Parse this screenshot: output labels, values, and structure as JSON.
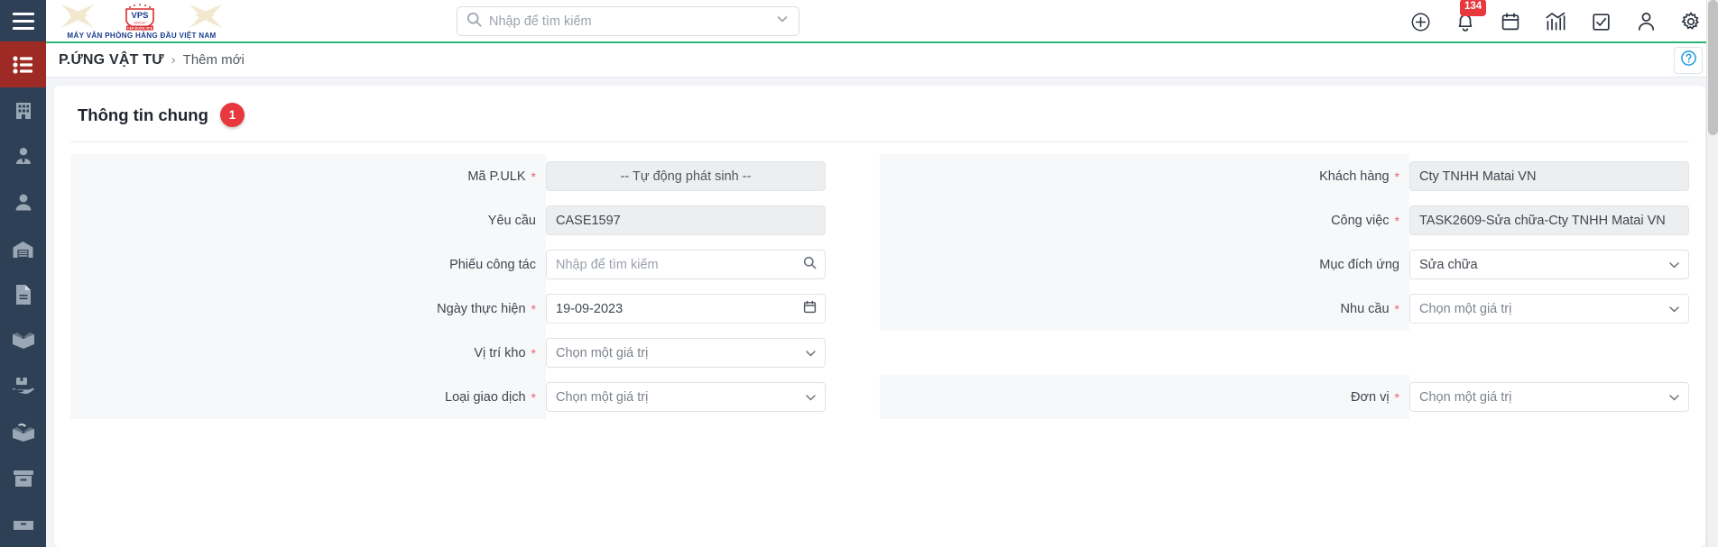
{
  "brand": {
    "logo_mark": "VPS",
    "logo_sub": "TẬP ĐOÀN VPS",
    "logo_tagline": "MÁY VĂN PHÒNG HÀNG ĐẦU VIỆT NAM"
  },
  "topbar": {
    "menu_icon": "hamburger-menu-icon",
    "search": {
      "placeholder": "Nhập để tìm kiếm",
      "value": "",
      "icon": "search-icon",
      "caret_icon": "chevron-down-icon"
    },
    "icons": [
      {
        "name": "add-circle-icon",
        "label": ""
      },
      {
        "name": "notification-bell-icon",
        "label": "",
        "badge": "134"
      },
      {
        "name": "calendar-icon",
        "label": ""
      },
      {
        "name": "analytics-chart-icon",
        "label": ""
      },
      {
        "name": "task-checkbox-icon",
        "label": ""
      },
      {
        "name": "user-account-icon",
        "label": ""
      },
      {
        "name": "settings-gear-icon",
        "label": ""
      }
    ]
  },
  "breadcrumb": {
    "root": "P.ỨNG VẬT TƯ",
    "separator": "›",
    "current": "Thêm mới",
    "help_icon": "question-circle-icon"
  },
  "sidebar": {
    "items": [
      {
        "name": "sidebar-item-list",
        "icon": "list-icon",
        "active": true
      },
      {
        "name": "sidebar-item-company",
        "icon": "building-icon",
        "active": false
      },
      {
        "name": "sidebar-item-employee",
        "icon": "user-tie-icon",
        "active": false
      },
      {
        "name": "sidebar-item-customer",
        "icon": "user-icon",
        "active": false
      },
      {
        "name": "sidebar-item-warehouse",
        "icon": "warehouse-icon",
        "active": false
      },
      {
        "name": "sidebar-item-document",
        "icon": "file-document-icon",
        "active": false
      },
      {
        "name": "sidebar-item-inbound",
        "icon": "box-open-icon",
        "active": false
      },
      {
        "name": "sidebar-item-delivery",
        "icon": "hand-holding-box-icon",
        "active": false
      },
      {
        "name": "sidebar-item-return",
        "icon": "box-return-icon",
        "active": false
      },
      {
        "name": "sidebar-item-archive",
        "icon": "archive-box-icon",
        "active": false
      },
      {
        "name": "sidebar-item-more",
        "icon": "drawer-icon",
        "active": false
      }
    ]
  },
  "card": {
    "title": "Thông tin chung",
    "step_badge": "1"
  },
  "form": {
    "left": [
      {
        "name": "ma-pulk",
        "label": "Mã P.ULK",
        "required": true,
        "control": "readonly-input",
        "value": "-- Tự động phát sinh --",
        "placeholder": ""
      },
      {
        "name": "yeu-cau",
        "label": "Yêu cầu",
        "required": false,
        "control": "readonly-input",
        "value": "CASE1597",
        "placeholder": ""
      },
      {
        "name": "phieu-cong-tac",
        "label": "Phiếu công tác",
        "required": false,
        "control": "search-input",
        "value": "",
        "placeholder": "Nhập để tìm kiếm",
        "addon_icon": "search-icon"
      },
      {
        "name": "ngay-thuc-hien",
        "label": "Ngày thực hiện",
        "required": true,
        "control": "date-input",
        "value": "19-09-2023",
        "placeholder": "",
        "addon_icon": "calendar-icon"
      },
      {
        "name": "vi-tri-kho",
        "label": "Vị trí kho",
        "required": true,
        "control": "select",
        "value": "",
        "placeholder": "Chọn một giá trị",
        "caret_icon": "chevron-down-icon"
      },
      {
        "name": "loai-giao-dich",
        "label": "Loại giao dịch",
        "required": true,
        "control": "select",
        "value": "",
        "placeholder": "Chọn một giá trị",
        "caret_icon": "chevron-down-icon"
      }
    ],
    "right": [
      {
        "name": "khach-hang",
        "label": "Khách hàng",
        "required": true,
        "control": "readonly-input",
        "value": "Cty TNHH Matai VN",
        "placeholder": ""
      },
      {
        "name": "cong-viec",
        "label": "Công việc",
        "required": true,
        "control": "readonly-input",
        "value": "TASK2609-Sửa chữa-Cty TNHH Matai VN",
        "placeholder": ""
      },
      {
        "name": "muc-dich-ung",
        "label": "Mục đích ứng",
        "required": false,
        "control": "select",
        "value": "Sửa chữa",
        "placeholder": "Chọn một giá trị",
        "caret_icon": "chevron-down-icon"
      },
      {
        "name": "nhu-cau",
        "label": "Nhu cầu",
        "required": true,
        "control": "select",
        "value": "",
        "placeholder": "Chọn một giá trị",
        "caret_icon": "chevron-down-icon"
      },
      {
        "name": "spacer-1",
        "label": "",
        "required": false,
        "control": "empty",
        "value": "",
        "placeholder": ""
      },
      {
        "name": "don-vi",
        "label": "Đơn vị",
        "required": true,
        "control": "select",
        "value": "",
        "placeholder": "Chọn một giá trị",
        "caret_icon": "chevron-down-icon"
      }
    ]
  },
  "colors": {
    "sidebar_bg": "#2e4055",
    "sidebar_active": "#9e2a25",
    "accent_green": "#2bb673",
    "badge_red": "#e8383d",
    "help_blue": "#1f9ae0",
    "content_bg": "#f2f4f7"
  }
}
